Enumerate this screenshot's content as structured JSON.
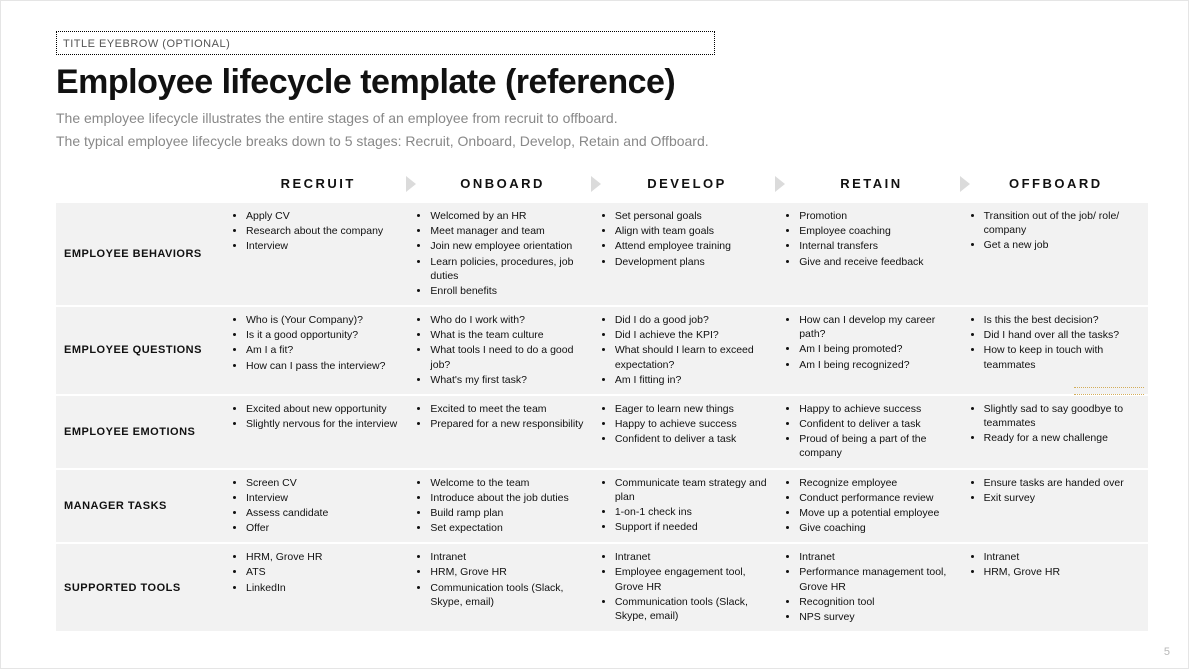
{
  "eyebrow": "TITLE EYEBROW (OPTIONAL)",
  "title_main": "Employee lifecycle template ",
  "title_paren": "(reference)",
  "subtitle_1": "The employee lifecycle illustrates the entire stages of an employee from recruit to offboard.",
  "subtitle_2": "The typical employee lifecycle breaks down to 5 stages: Recruit, Onboard, Develop, Retain and Offboard.",
  "stages": [
    "RECRUIT",
    "ONBOARD",
    "DEVELOP",
    "RETAIN",
    "OFFBOARD"
  ],
  "rows": [
    {
      "label": "EMPLOYEE BEHAVIORS",
      "cells": [
        [
          "Apply CV",
          "Research about the company",
          "Interview"
        ],
        [
          "Welcomed by an HR",
          "Meet manager and team",
          "Join new employee orientation",
          "Learn policies, procedures, job duties",
          "Enroll benefits"
        ],
        [
          "Set personal goals",
          "Align with team goals",
          "Attend employee training",
          "Development plans"
        ],
        [
          "Promotion",
          "Employee coaching",
          "Internal transfers",
          "Give and receive feedback"
        ],
        [
          "Transition out of the job/ role/ company",
          "Get a new job"
        ]
      ]
    },
    {
      "label": "EMPLOYEE QUESTIONS",
      "cells": [
        [
          "Who is (Your Company)?",
          "Is it a good opportunity?",
          "Am I a fit?",
          "How can I pass the interview?"
        ],
        [
          "Who do I work with?",
          "What is the team culture",
          "What tools I need to do a good job?",
          "What's my first task?"
        ],
        [
          "Did I do a good job?",
          "Did I achieve the KPI?",
          "What should I learn to exceed expectation?",
          "Am I fitting in?"
        ],
        [
          "How can I develop my career path?",
          "Am I being promoted?",
          "Am I being recognized?"
        ],
        [
          "Is this the best decision?",
          "Did I hand over all the tasks?",
          "How to keep in touch with teammates"
        ]
      ]
    },
    {
      "label": "EMPLOYEE EMOTIONS",
      "cells": [
        [
          "Excited about new opportunity",
          "Slightly nervous for the interview"
        ],
        [
          "Excited to meet the team",
          "Prepared for a new responsibility"
        ],
        [
          "Eager to learn new things",
          "Happy to achieve success",
          "Confident to deliver a task"
        ],
        [
          "Happy to achieve success",
          "Confident to deliver a task",
          "Proud of being a part of the company"
        ],
        [
          "Slightly sad to say goodbye to teammates",
          "Ready for a new challenge"
        ]
      ]
    },
    {
      "label": "MANAGER TASKS",
      "cells": [
        [
          "Screen CV",
          "Interview",
          "Assess candidate",
          "Offer"
        ],
        [
          "Welcome to the team",
          "Introduce about the job duties",
          "Build ramp plan",
          "Set expectation"
        ],
        [
          "Communicate team strategy and plan",
          "1-on-1 check ins",
          "Support if needed"
        ],
        [
          "Recognize employee",
          "Conduct performance review",
          "Move up a potential employee",
          "Give coaching"
        ],
        [
          "Ensure tasks are handed over",
          "Exit survey"
        ]
      ]
    },
    {
      "label": "SUPPORTED TOOLS",
      "cells": [
        [
          "HRM, Grove HR",
          "ATS",
          "LinkedIn"
        ],
        [
          "Intranet",
          "HRM, Grove HR",
          "Communication tools (Slack, Skype, email)"
        ],
        [
          "Intranet",
          "Employee engagement tool, Grove HR",
          "Communication tools (Slack, Skype, email)"
        ],
        [
          "Intranet",
          "Performance management tool, Grove HR",
          "Recognition tool",
          "NPS survey"
        ],
        [
          "Intranet",
          "HRM, Grove HR"
        ]
      ]
    }
  ],
  "page_number": "5"
}
